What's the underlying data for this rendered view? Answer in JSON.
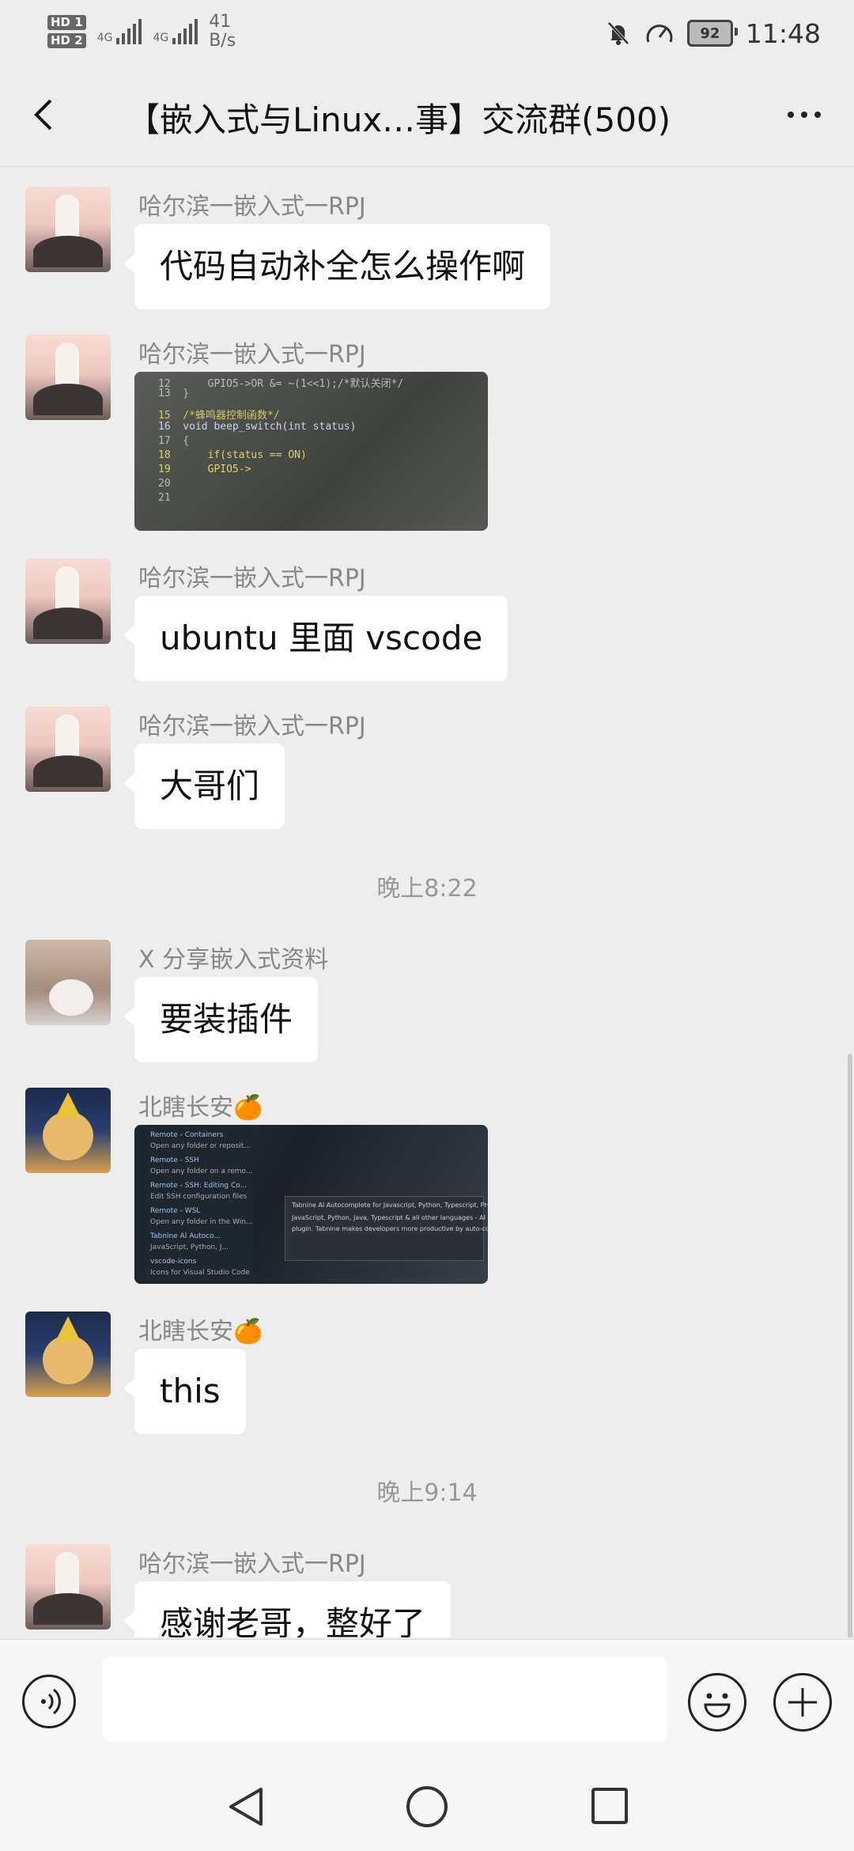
{
  "status_bar": {
    "sim1": "HD 1",
    "sim2": "HD 2",
    "net1": "4G",
    "net2": "4G",
    "speed_value": "41",
    "speed_unit": "B/s",
    "battery": "92",
    "time": "11:48"
  },
  "header": {
    "title": "【嵌入式与Linux…事】交流群(500)"
  },
  "messages": [
    {
      "sender": "哈尔滨一嵌入式一RPJ",
      "type": "text",
      "text": "代码自动补全怎么操作啊",
      "avatar": "rabbit"
    },
    {
      "sender": "哈尔滨一嵌入式一RPJ",
      "type": "image",
      "image": "code-editor-photo",
      "avatar": "rabbit",
      "code_lines": [
        "12      GPIO5->OR &= ~(1<<1);/*默认关闭*/",
        "13  }",
        "15  /*蜂鸣器控制函数*/",
        "16  void beep_switch(int status)",
        "17  {",
        "18      if(status == ON)",
        "19      GPIO5->",
        "20",
        "21"
      ]
    },
    {
      "sender": "哈尔滨一嵌入式一RPJ",
      "type": "text",
      "text": "ubuntu 里面 vscode",
      "avatar": "rabbit"
    },
    {
      "sender": "哈尔滨一嵌入式一RPJ",
      "type": "text",
      "text": "大哥们",
      "avatar": "rabbit"
    },
    {
      "sender": "X 分享嵌入式资料",
      "type": "text",
      "text": "要装插件",
      "avatar": "cat"
    },
    {
      "sender": "北瞎长安🍊",
      "type": "image",
      "image": "vscode-extensions-photo",
      "avatar": "dog",
      "ext_lines": [
        "Remote - Containers",
        "Open any folder or reposit...",
        "Remote - SSH",
        "Open any folder on a remo...",
        "Remote - SSH: Editing Co...",
        "Edit SSH configuration files",
        "Remote - WSL",
        "Open any folder in the Win...",
        "Tabnine AI Autoco...",
        "JavaScript, Python, J...",
        "vscode-icons",
        "Icons for Visual Studio Code"
      ],
      "popup_lines": [
        "Tabnine AI Autocomplete for Javascript, Python, Typescript, PHP, Go, Java, Ruby",
        "JavaScript, Python, Java, Typescript & all other languages - AI Code completion",
        "plugin. Tabnine makes developers more productive by auto-completing their code."
      ]
    },
    {
      "sender": "北瞎长安🍊",
      "type": "text",
      "text": "this",
      "avatar": "dog"
    },
    {
      "sender": "哈尔滨一嵌入式一RPJ",
      "type": "text",
      "text": "感谢老哥，整好了",
      "avatar": "rabbit"
    }
  ],
  "timestamps": [
    "晚上8:22",
    "晚上9:14"
  ]
}
